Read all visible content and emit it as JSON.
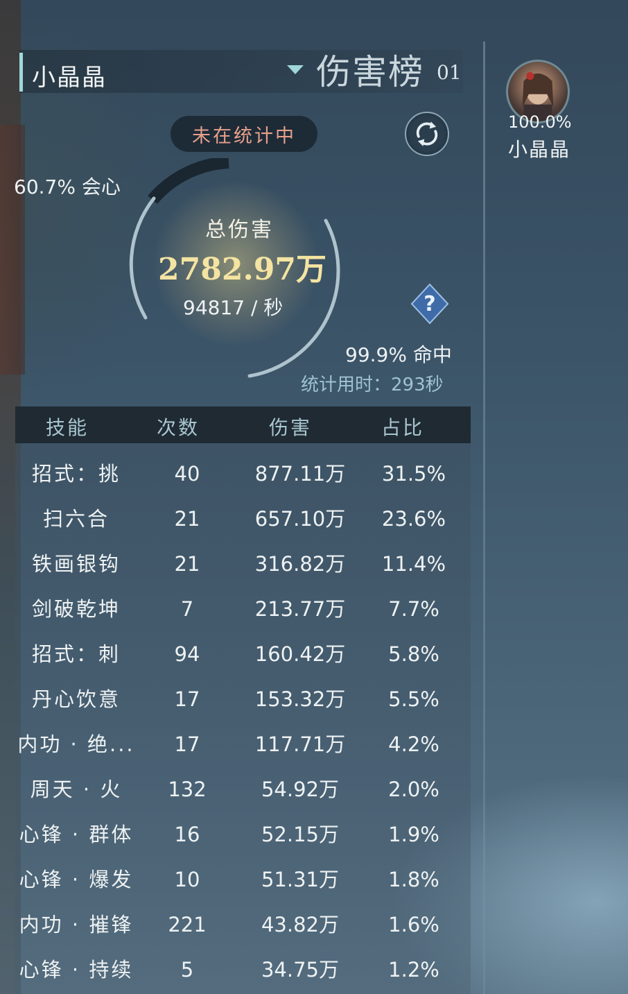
{
  "header": {
    "player_name": "小晶晶",
    "board_title": "伤害榜",
    "board_number": "01"
  },
  "status": {
    "text": "未在统计中"
  },
  "summary": {
    "crit_rate": "60.7% 会心",
    "total_label": "总伤害",
    "total_damage": "2782.97万",
    "dps": "94817 / 秒",
    "hit_rate": "99.9% 命中",
    "duration": "统计用时：293秒"
  },
  "table": {
    "headers": [
      "技能",
      "次数",
      "伤害",
      "占比"
    ],
    "rows": [
      {
        "skill": "招式：挑",
        "count": "40",
        "damage": "877.11万",
        "percent": "31.5%"
      },
      {
        "skill": "扫六合",
        "count": "21",
        "damage": "657.10万",
        "percent": "23.6%"
      },
      {
        "skill": "铁画银钩",
        "count": "21",
        "damage": "316.82万",
        "percent": "11.4%"
      },
      {
        "skill": "剑破乾坤",
        "count": "7",
        "damage": "213.77万",
        "percent": "7.7%"
      },
      {
        "skill": "招式：刺",
        "count": "94",
        "damage": "160.42万",
        "percent": "5.8%"
      },
      {
        "skill": "丹心饮意",
        "count": "17",
        "damage": "153.32万",
        "percent": "5.5%"
      },
      {
        "skill": "内功 · 绝...",
        "count": "17",
        "damage": "117.71万",
        "percent": "4.2%"
      },
      {
        "skill": "周天 · 火",
        "count": "132",
        "damage": "54.92万",
        "percent": "2.0%"
      },
      {
        "skill": "心锋 · 群体",
        "count": "16",
        "damage": "52.15万",
        "percent": "1.9%"
      },
      {
        "skill": "心锋 · 爆发",
        "count": "10",
        "damage": "51.31万",
        "percent": "1.8%"
      },
      {
        "skill": "内功 · 摧锋",
        "count": "221",
        "damage": "43.82万",
        "percent": "1.6%"
      },
      {
        "skill": "心锋 · 持续",
        "count": "5",
        "damage": "34.75万",
        "percent": "1.2%"
      }
    ]
  },
  "side_panel": {
    "members": [
      {
        "name": "小晶晶",
        "percent": "100.0%"
      }
    ]
  },
  "icons": {
    "dropdown": "chevron-down-icon",
    "refresh": "refresh-icon",
    "help": "question-icon"
  },
  "colors": {
    "accent": "#9fd8d8",
    "status_text": "#e8a08c",
    "total_value": "#f4e4a2",
    "duration_text": "#9fc3cf"
  }
}
